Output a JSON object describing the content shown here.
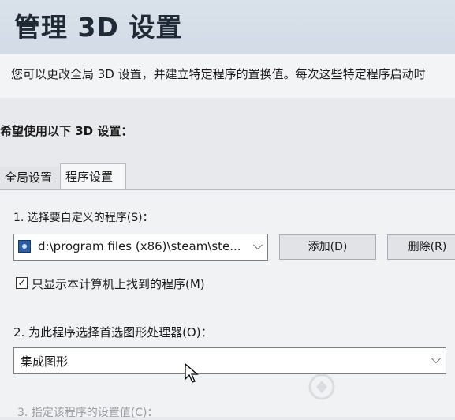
{
  "header": {
    "title": "管理 3D 设置"
  },
  "description": "您可以更改全局 3D 设置，并建立特定程序的置换值。每次这些特定程序启动时",
  "prompt": "希望使用以下 3D 设置：",
  "tabs": [
    {
      "label": "全局设置",
      "active": false
    },
    {
      "label": "程序设置",
      "active": true
    }
  ],
  "program_settings": {
    "step1_label": "1. 选择要自定义的程序(S)：",
    "program_select": {
      "value": "d:\\program files (x86)\\steam\\ste...",
      "icon": "application-icon"
    },
    "add_button": "添加(D)",
    "remove_button": "删除(R)",
    "checkbox": {
      "label": "只显示本计算机上找到的程序(M)",
      "checked": true,
      "mark": "✓"
    },
    "step2_label": "2. 为此程序选择首选图形处理器(O)：",
    "gpu_select": {
      "value": "集成图形"
    },
    "step3_label": "3. 指定该程序的设置值(C)："
  },
  "icons": {
    "chevron": "chevron-down-icon",
    "cursor": "mouse-pointer-icon"
  }
}
